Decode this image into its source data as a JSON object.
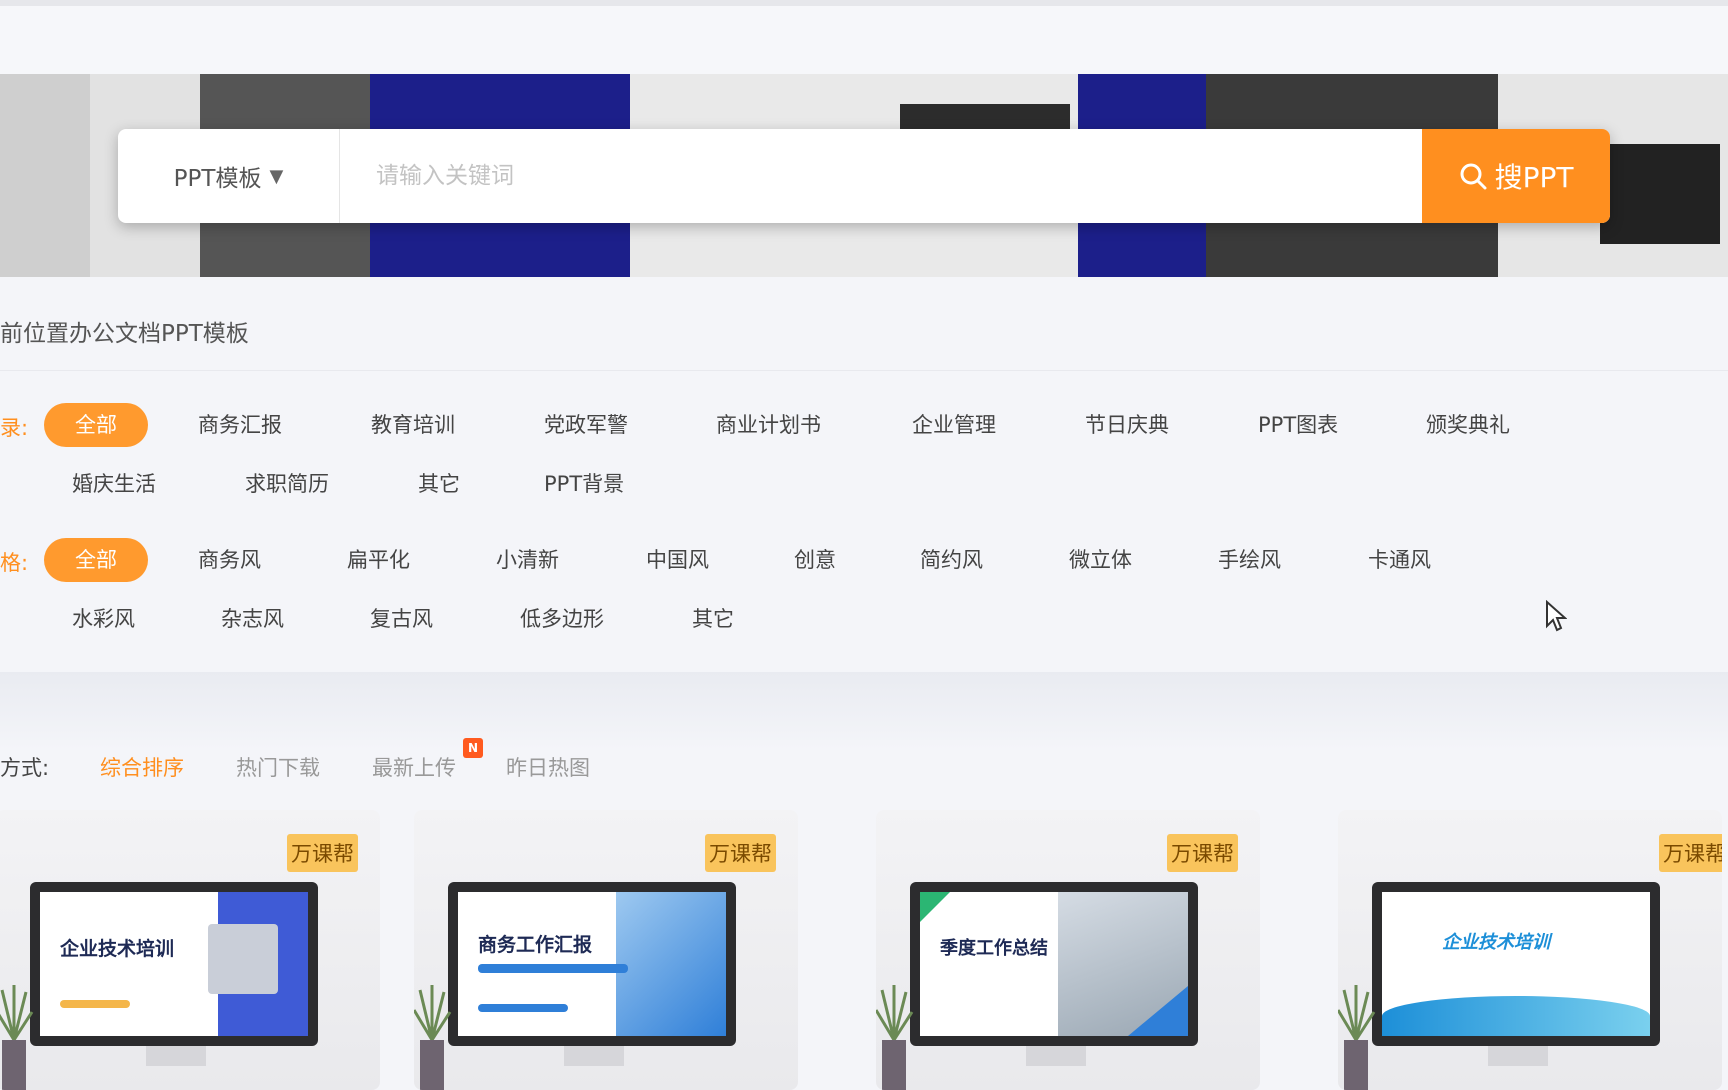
{
  "search": {
    "type_label": "PPT模板",
    "placeholder": "请输入关键词",
    "button_label": "搜PPT"
  },
  "breadcrumb": "前位置办公文档PPT模板",
  "filters": {
    "category": {
      "label": "录:",
      "items": [
        "全部",
        "商务汇报",
        "教育培训",
        "党政军警",
        "商业计划书",
        "企业管理",
        "节日庆典",
        "PPT图表",
        "颁奖典礼",
        "婚庆生活",
        "求职简历",
        "其它",
        "PPT背景"
      ],
      "active": "全部"
    },
    "style": {
      "label": "格:",
      "items": [
        "全部",
        "商务风",
        "扁平化",
        "小清新",
        "中国风",
        "创意",
        "简约风",
        "微立体",
        "手绘风",
        "卡通风",
        "水彩风",
        "杂志风",
        "复古风",
        "低多边形",
        "其它"
      ],
      "active": "全部"
    }
  },
  "sort": {
    "label": "方式:",
    "options": [
      "综合排序",
      "热门下载",
      "最新上传",
      "昨日热图"
    ],
    "active": "综合排序",
    "new_badge": "N"
  },
  "cards": [
    {
      "tag": "万课帮",
      "title": "企业技术培训",
      "accent": "#3f5bd6"
    },
    {
      "tag": "万课帮",
      "title": "商务工作汇报",
      "accent": "#2f7fd8"
    },
    {
      "tag": "万课帮",
      "title": "季度工作总结",
      "accent": "#2bb673"
    },
    {
      "tag": "万课帮",
      "title": "企业技术培训",
      "accent": "#1d8fd8"
    }
  ],
  "colors": {
    "accent": "#ff8f1f",
    "active_chip": "#ff9a2e",
    "tag_bg": "#f9c45c"
  }
}
